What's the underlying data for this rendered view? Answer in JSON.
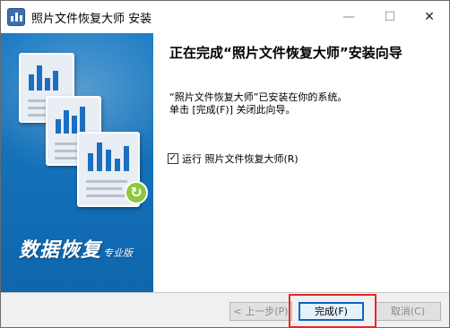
{
  "window": {
    "title": "照片文件恢复大师 安装",
    "minimize_glyph": "—",
    "maximize_glyph": "☐",
    "close_glyph": "✕"
  },
  "banner": {
    "brand_main": "数据恢复",
    "brand_sub": "专业版",
    "refresh_glyph": "↻"
  },
  "content": {
    "heading": "正在完成“照片文件恢复大师”安装向导",
    "line1": "“照片文件恢复大师”已安装在你的系统。",
    "line2": "单击 [完成(F)] 关闭此向导。",
    "checkbox_label": "运行 照片文件恢复大师(R)",
    "checkbox_checked": true,
    "check_glyph": "✓"
  },
  "buttons": {
    "back": "< 上一步(P)",
    "finish": "完成(F)",
    "cancel": "取消(C)"
  },
  "colors": {
    "banner": "#1471b9",
    "highlight": "#e8262b",
    "primary_border": "#0a64c8"
  },
  "icons": {
    "app": "app-chart-icon",
    "banner_docs": "chart-document-icon",
    "refresh": "refresh-icon"
  }
}
